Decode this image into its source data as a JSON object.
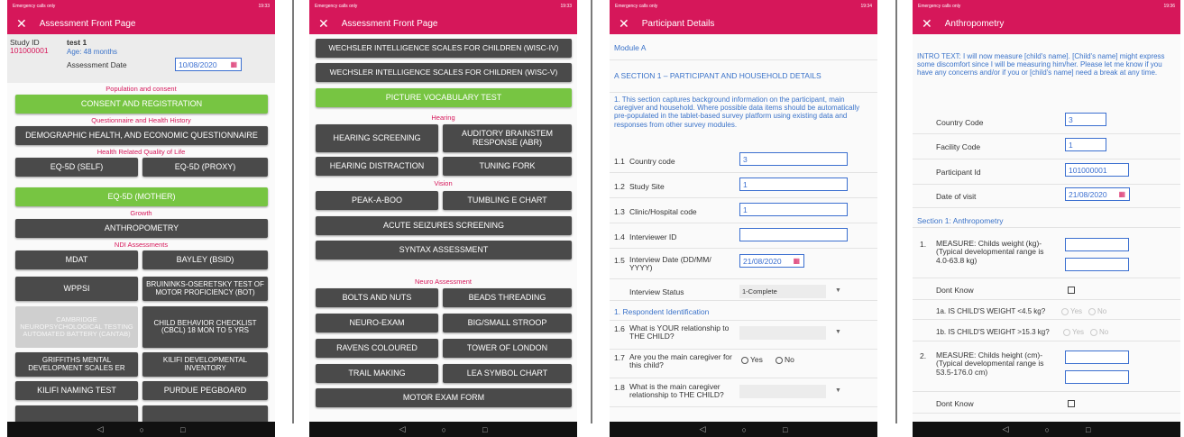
{
  "statusbar": {
    "s1": {
      "left": "Emergency calls only",
      "right": "19:33"
    },
    "s2": {
      "left": "Emergency calls only",
      "right": "19:33"
    },
    "s3": {
      "left": "Emergency calls only",
      "right": "19:34"
    },
    "s4": {
      "left": "Emergency calls only",
      "right": "19:36"
    }
  },
  "screen1": {
    "title": "Assessment Front Page",
    "study_id_label": "Study ID",
    "study_id_value": "101000001",
    "participant_name": "test 1",
    "age": "Age: 48 months",
    "assessment_date_label": "Assessment Date",
    "assessment_date_value": "10/08/2020",
    "sections": {
      "pop": "Population and consent",
      "qhh": "Questionnaire and Health History",
      "hrql": "Health Related Quality of Life",
      "growth": "Growth",
      "ndi": "NDI Assessments"
    },
    "buttons": {
      "consent": "CONSENT AND REGISTRATION",
      "demographic": "DEMOGRAPHIC HEALTH, AND ECONOMIC QUESTIONNAIRE",
      "eq_self": "EQ-5D (SELF)",
      "eq_proxy": "EQ-5D (PROXY)",
      "eq_mother": "EQ-5D (MOTHER)",
      "anthro": "ANTHROPOMETRY",
      "mdat": "MDAT",
      "bayley": "BAYLEY (BSID)",
      "wppsi": "WPPSI",
      "bruininks": "BRUININKS-OSERETSKY TEST OF MOTOR PROFICIENCY (BOT)",
      "cantab": "CAMBRIDGE NEUROPSYCHOLOGICAL TESTING AUTOMATED BATTERY (CANTAB)",
      "cbcl": "CHILD BEHAVIOR CHECKLIST (CBCL) 18 MON TO 5 YRS",
      "griffiths": "GRIFFITHS MENTAL DEVELOPMENT SCALES ER",
      "kilifi_dev": "KILIFI DEVELOPMENTAL INVENTORY",
      "kilifi_naming": "KILIFI NAMING TEST",
      "purdue": "PURDUE PEGBOARD"
    }
  },
  "screen2": {
    "title": "Assessment Front Page",
    "sections": {
      "hearing": "Hearing",
      "vision": "Vision",
      "neuro": "Neuro Assessment"
    },
    "buttons": {
      "wisc4": "WECHSLER INTELLIGENCE SCALES FOR CHILDREN (WISC-IV)",
      "wisc5": "WECHSLER INTELLIGENCE SCALES FOR CHILDREN (WISC-V)",
      "pvt": "PICTURE VOCABULARY TEST",
      "hearing_screening": "HEARING SCREENING",
      "abr": "AUDITORY BRAINSTEM RESPONSE (ABR)",
      "hearing_distraction": "HEARING DISTRACTION",
      "tuning_fork": "TUNING FORK",
      "peekaboo": "PEAK-A-BOO",
      "tumbling": "TUMBLING E CHART",
      "seizures": "ACUTE SEIZURES SCREENING",
      "syntax": "SYNTAX ASSESSMENT",
      "bolts": "BOLTS AND NUTS",
      "beads": "BEADS THREADING",
      "neuro_exam": "NEURO-EXAM",
      "stroop": "BIG/SMALL STROOP",
      "ravens": "RAVENS COLOURED",
      "tower": "TOWER OF LONDON",
      "trail": "TRAIL MAKING",
      "lea": "LEA SYMBOL CHART",
      "motor": "MOTOR EXAM FORM"
    }
  },
  "screen3": {
    "title": "Participant Details",
    "module": "Module A",
    "section_a": "A SECTION 1 – PARTICIPANT AND HOUSEHOLD DETAILS",
    "intro": "1. This section captures background information on the participant, main caregiver and household. Where possible data items should be automatically pre-populated in the tablet-based survey platform using existing data and responses from other survey modules.",
    "fields": {
      "f11_num": "1.1",
      "f11_label": "Country code",
      "f11_value": "3",
      "f12_num": "1.2",
      "f12_label": "Study Site",
      "f12_value": "1",
      "f13_num": "1.3",
      "f13_label": "Clinic/Hospital code",
      "f13_value": "1",
      "f14_num": "1.4",
      "f14_label": "Interviewer ID",
      "f14_value": "",
      "f15_num": "1.5",
      "f15_label": "Interview Date (DD/MM/ YYYY)",
      "f15_value": "21/08/2020",
      "status_label": "Interview Status",
      "status_value": "1-Complete"
    },
    "resp_section": "1. Respondent Identification",
    "q16_num": "1.6",
    "q16": "What is YOUR relationship to THE CHILD?",
    "q17_num": "1.7",
    "q17": "Are you the main caregiver for this child?",
    "yes": "Yes",
    "no": "No",
    "q18_num": "1.8",
    "q18": "What is the main caregiver relationship to THE CHILD?"
  },
  "screen4": {
    "title": "Anthropometry",
    "intro": "INTRO TEXT: I will now measure [child's name]. [Child's name] might express some discomfort since I will be measuring him/her. Please let me know if you have any concerns and/or if you or [child's name] need a break at any time.",
    "country_label": "Country Code",
    "country_value": "3",
    "facility_label": "Facility Code",
    "facility_value": "1",
    "participant_label": "Participant Id",
    "participant_value": "101000001",
    "visit_label": "Date of visit",
    "visit_value": "21/08/2020",
    "section1": "Section 1: Anthropometry",
    "m1_num": "1.",
    "m1": "MEASURE: Childs weight (kg)- (Typical developmental range is 4.0-63.8 kg)",
    "dont_know": "Dont Know",
    "q1a": "1a. IS CHILD'S WEIGHT <4.5 kg?",
    "q1b": "1b. IS CHILD'S WEIGHT >15.3 kg?",
    "yes": "Yes",
    "no": "No",
    "m2_num": "2.",
    "m2": "MEASURE: Childs height (cm)- (Typical developmental range is 53.5-176.0 cm)",
    "dont_know2": "Dont Know"
  },
  "nav": {
    "back": "◁",
    "home": "○",
    "recent": "□"
  },
  "colors": {
    "accent": "#d6175a",
    "button": "#4a4a4a",
    "active": "#77c542",
    "link": "#3b73c9"
  }
}
